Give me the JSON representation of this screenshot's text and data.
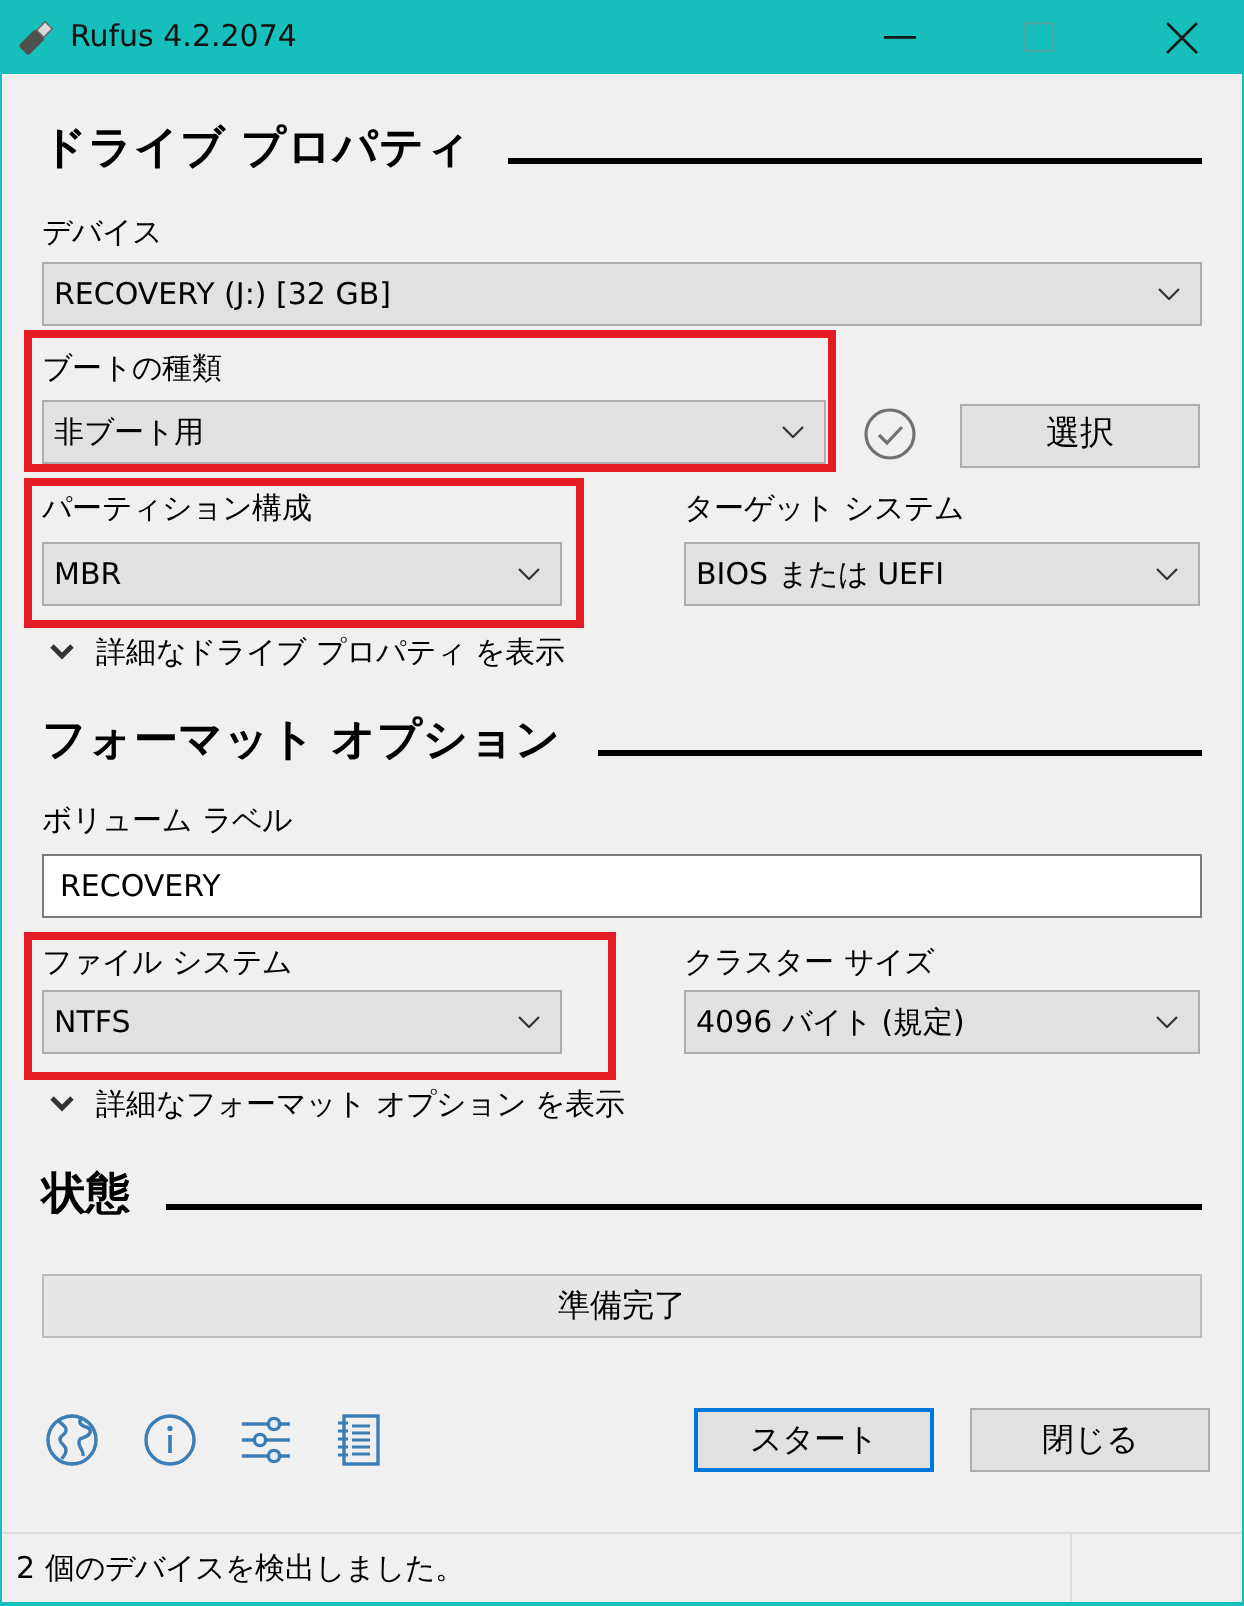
{
  "window": {
    "title": "Rufus 4.2.2074",
    "controls": [
      {
        "kind": "minimize",
        "disabled": false
      },
      {
        "kind": "maximize",
        "disabled": true
      },
      {
        "kind": "close",
        "disabled": false
      }
    ]
  },
  "drive_properties": {
    "heading": "ドライブ プロパティ",
    "device": {
      "label": "デバイス",
      "value": "RECOVERY (J:) [32 GB]",
      "highlighted": false
    },
    "boot_selection": {
      "label": "ブートの種類",
      "value": "非ブート用",
      "highlighted": true
    },
    "select_button": {
      "label": "選択"
    },
    "partition_scheme": {
      "label": "パーティション構成",
      "value": "MBR",
      "highlighted": true
    },
    "target_system": {
      "label": "ターゲット システム",
      "value": "BIOS または UEFI",
      "highlighted": false
    },
    "advanced_toggle": {
      "label": "詳細なドライブ プロパティ を表示",
      "expanded": false
    }
  },
  "format_options": {
    "heading": "フォーマット オプション",
    "volume_label": {
      "label": "ボリューム ラベル",
      "value": "RECOVERY",
      "highlighted": false
    },
    "file_system": {
      "label": "ファイル システム",
      "value": "NTFS",
      "highlighted": true
    },
    "cluster_size": {
      "label": "クラスター サイズ",
      "value": "4096 バイト (規定)",
      "highlighted": false
    },
    "advanced_toggle": {
      "label": "詳細なフォーマット オプション を表示",
      "expanded": false
    }
  },
  "status": {
    "heading": "状態",
    "display": {
      "text": "準備完了"
    }
  },
  "actions": [
    {
      "label": "スタート",
      "default": true
    },
    {
      "label": "閉じる",
      "default": false
    }
  ],
  "status_bar": {
    "text": "2 個のデバイスを検出しました。"
  }
}
